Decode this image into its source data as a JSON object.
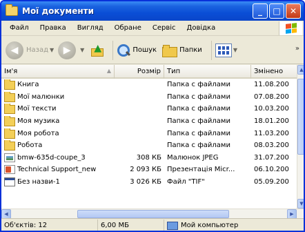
{
  "window": {
    "title": "Мої документи"
  },
  "menu": [
    "Файл",
    "Правка",
    "Вигляд",
    "Обране",
    "Сервіс",
    "Довідка"
  ],
  "toolbar": {
    "back": "Назад",
    "search": "Пошук",
    "folders": "Папки",
    "more": "»"
  },
  "columns": {
    "name": "Ім'я",
    "size": "Розмір",
    "type": "Тип",
    "date": "Змінено",
    "sort_arrow": "▲"
  },
  "files": [
    {
      "name": "Книга",
      "size": "",
      "type": "Папка с файлами",
      "date": "11.08.200",
      "icon": "folder"
    },
    {
      "name": "Мої малюнки",
      "size": "",
      "type": "Папка с файлами",
      "date": "07.08.200",
      "icon": "folder"
    },
    {
      "name": "Мої тексти",
      "size": "",
      "type": "Папка с файлами",
      "date": "10.03.200",
      "icon": "folder"
    },
    {
      "name": "Моя музика",
      "size": "",
      "type": "Папка с файлами",
      "date": "18.01.200",
      "icon": "folder"
    },
    {
      "name": "Моя робота",
      "size": "",
      "type": "Папка с файлами",
      "date": "11.03.200",
      "icon": "folder"
    },
    {
      "name": "Робота",
      "size": "",
      "type": "Папка с файлами",
      "date": "08.03.200",
      "icon": "folder"
    },
    {
      "name": "bmw-635d-coupe_3",
      "size": "308 КБ",
      "type": "Малюнок JPEG",
      "date": "31.07.200",
      "icon": "jpeg"
    },
    {
      "name": "Technical Support_new",
      "size": "2 093 КБ",
      "type": "Презентація Micr...",
      "date": "06.10.200",
      "icon": "ppt"
    },
    {
      "name": "Без назви-1",
      "size": "3 026 КБ",
      "type": "Файл \"TIF\"",
      "date": "05.09.200",
      "icon": "tif"
    }
  ],
  "status": {
    "count": "Об'єктів: 12",
    "size": "6,00 МБ",
    "location": "Мой компьютер"
  }
}
